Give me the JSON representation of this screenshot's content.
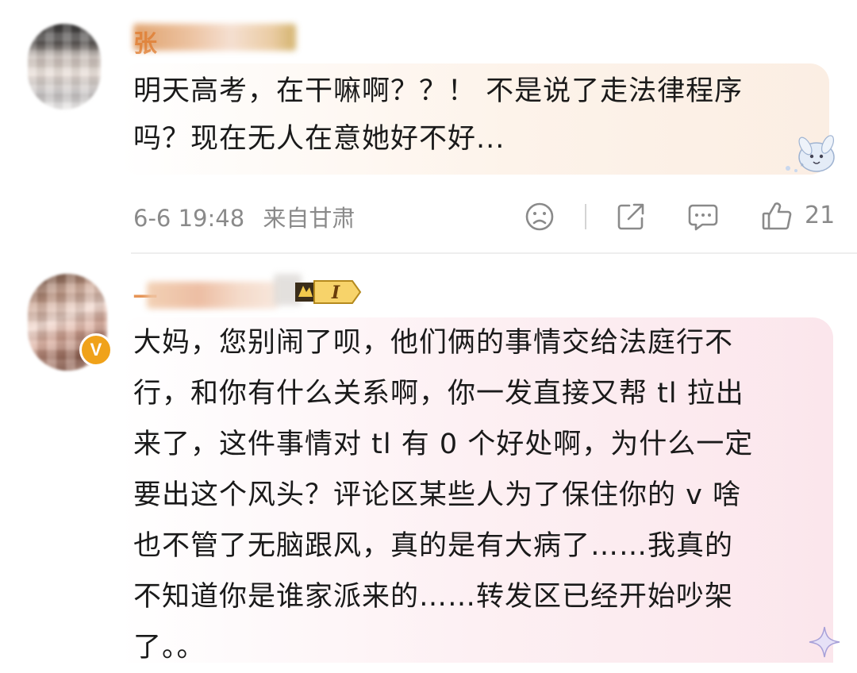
{
  "comments": [
    {
      "author_visible": "张",
      "text": "明天高考，在干嘛啊？？！ 不是说了走法律程序吗？现在无人在意她好不好...",
      "text_lines": [
        "明天高考，在干嘛啊？？！ 不是说了走法律程序",
        "吗？现在无人在意她好不好..."
      ],
      "time": "6-6 19:48",
      "location": "来自甘肃",
      "likes": "21"
    },
    {
      "author_visible": "一",
      "level_badge": "I",
      "verified_badge": "V",
      "text_lines": [
        "大妈，您别闹了呗，他们俩的事情交给法庭行不",
        "行，和你有什么关系啊，你一发直接又帮 tl 拉出",
        "来了，这件事情对 tl 有 0 个好处啊，为什么一定",
        "要出这个风头？评论区某些人为了保住你的 v 啥",
        "也不管了无脑跟风，真的是有大病了……我真的",
        "不知道你是谁家派来的……转发区已经开始吵架",
        "了。。"
      ]
    }
  ],
  "icons": {
    "dislike": "dislike-face-icon",
    "share": "share-icon",
    "reply": "comment-icon",
    "like": "thumbs-up-icon"
  },
  "colors": {
    "username": "#e07a2c",
    "meta_gray": "#8a8a8a",
    "bubble1": "#fdf3ea",
    "bubble2": "#fdf0f3"
  }
}
